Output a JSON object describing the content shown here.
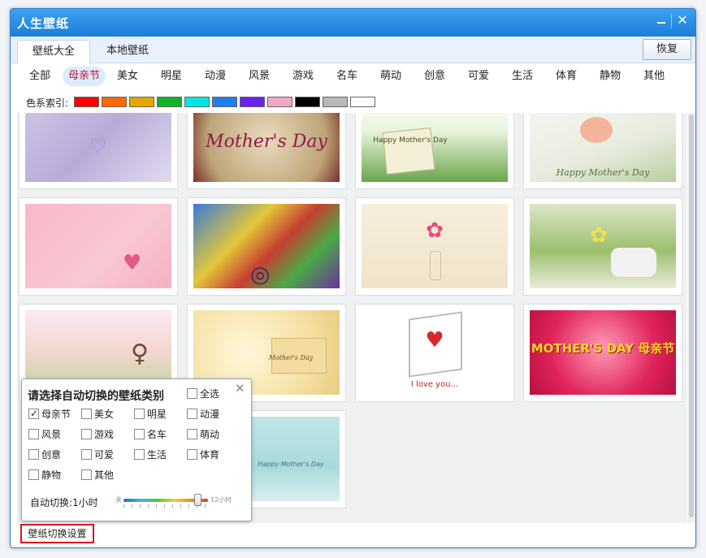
{
  "window": {
    "title": "人生壁纸"
  },
  "tabs": {
    "all": "壁纸大全",
    "local": "本地壁纸",
    "restore": "恢复"
  },
  "categories": [
    "全部",
    "母亲节",
    "美女",
    "明星",
    "动漫",
    "风景",
    "游戏",
    "名车",
    "萌动",
    "创意",
    "可爱",
    "生活",
    "体育",
    "静物",
    "其他"
  ],
  "selected_category": "母亲节",
  "color_index": {
    "label": "色系索引:",
    "swatches": [
      "#ff0000",
      "#ff6a00",
      "#e5a600",
      "#11b22a",
      "#00e5e0",
      "#1f7ef0",
      "#6b22ef",
      "#f2a7c8",
      "#000000",
      "#b8b8b8",
      "#ffffff"
    ]
  },
  "thumbnails": [
    {
      "caption": ""
    },
    {
      "caption": "Mother's Day"
    },
    {
      "caption": "Happy Mother's Day"
    },
    {
      "caption": "Happy Mother's Day"
    },
    {
      "caption": ""
    },
    {
      "caption": ""
    },
    {
      "caption": ""
    },
    {
      "caption": ""
    },
    {
      "caption": ""
    },
    {
      "caption": "Mother's Day"
    },
    {
      "caption": "I love you..."
    },
    {
      "caption": "MOTHER'S DAY 母亲节"
    },
    {
      "caption": "Happy Mother's Day"
    }
  ],
  "popup": {
    "title": "请选择自动切换的壁纸类别",
    "options": [
      {
        "label": "全选",
        "checked": false
      },
      {
        "label": "母亲节",
        "checked": true
      },
      {
        "label": "美女",
        "checked": false
      },
      {
        "label": "明星",
        "checked": false
      },
      {
        "label": "动漫",
        "checked": false
      },
      {
        "label": "风景",
        "checked": false
      },
      {
        "label": "游戏",
        "checked": false
      },
      {
        "label": "名车",
        "checked": false
      },
      {
        "label": "萌动",
        "checked": false
      },
      {
        "label": "创意",
        "checked": false
      },
      {
        "label": "可爱",
        "checked": false
      },
      {
        "label": "生活",
        "checked": false
      },
      {
        "label": "体育",
        "checked": false
      },
      {
        "label": "静物",
        "checked": false
      },
      {
        "label": "其他",
        "checked": false
      }
    ],
    "auto_switch_label": "自动切换:1小时",
    "slider_min_label": "关",
    "slider_max_label": "12小时",
    "slider_value_fraction": 0.92
  },
  "settings_button": "壁纸切换设置"
}
